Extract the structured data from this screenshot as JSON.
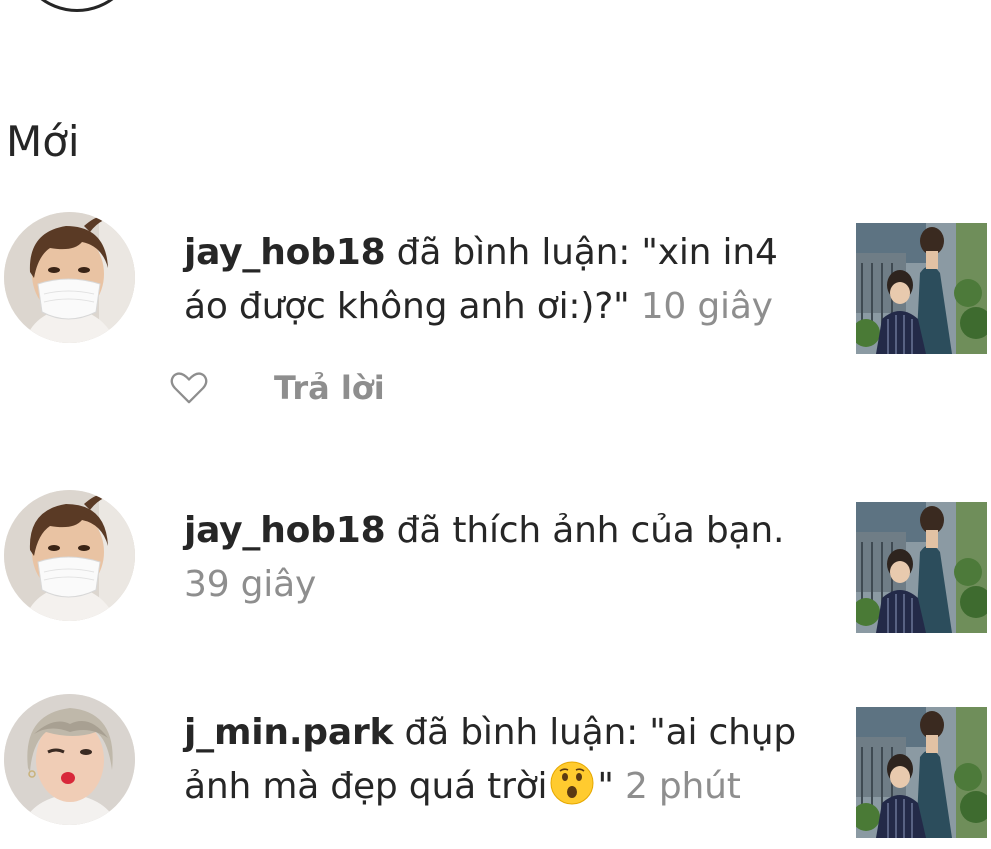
{
  "section": {
    "title": "Mới"
  },
  "notifications": [
    {
      "username": "jay_hob18",
      "action": " đã bình luận: \"xin in4 áo được không anh ơi:)?\" ",
      "time": "10 giây",
      "reply_label": "Trả lời",
      "avatar_icon": "avatar-masked-person",
      "thumb_icon": "post-thumbnail"
    },
    {
      "username": "jay_hob18",
      "action": " đã thích ảnh của bạn. ",
      "time": "39 giây",
      "avatar_icon": "avatar-masked-person",
      "thumb_icon": "post-thumbnail"
    },
    {
      "username": "j_min.park",
      "action_before_emoji": " đã bình luận: \"ai chụp ảnh mà đẹp quá trời",
      "emoji": "surprised-face-emoji",
      "action_after_emoji": "\" ",
      "time": "2 phút",
      "avatar_icon": "avatar-blonde-person",
      "thumb_icon": "post-thumbnail"
    }
  ],
  "colors": {
    "text": "#262626",
    "secondary": "#8e8e8e",
    "background": "#ffffff"
  }
}
